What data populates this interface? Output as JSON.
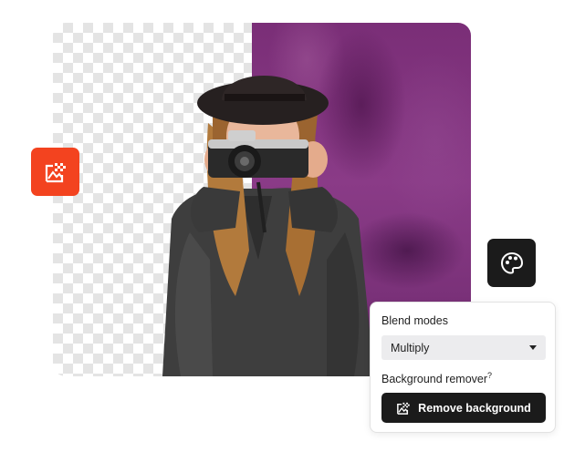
{
  "panel": {
    "blend_modes_label": "Blend modes",
    "blend_mode_value": "Multiply",
    "background_remover_label": "Background remover",
    "background_remover_help": "?",
    "remove_button_label": "Remove background"
  },
  "icons": {
    "left_tool": "image-remove-bg-icon",
    "right_tool": "palette-icon",
    "button": "image-remove-bg-icon"
  },
  "colors": {
    "accent_red": "#f3431f",
    "dark": "#1b1b1b",
    "purple_bg": "#7a2e77"
  }
}
